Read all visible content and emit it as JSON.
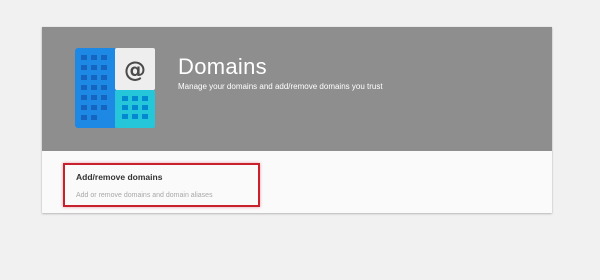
{
  "header": {
    "title": "Domains",
    "subtitle": "Manage your domains and add/remove domains you trust",
    "icon": "domains-building-at-icon",
    "background_color": "#8e8e8e"
  },
  "settings": [
    {
      "title": "Add/remove domains",
      "description": "Add or remove domains and domain aliases",
      "highlighted": true,
      "highlight_color": "#c8202c"
    }
  ],
  "colors": {
    "page_background": "#f1f1f1",
    "logo_blue": "#1e88e5",
    "logo_teal": "#26c6da"
  }
}
